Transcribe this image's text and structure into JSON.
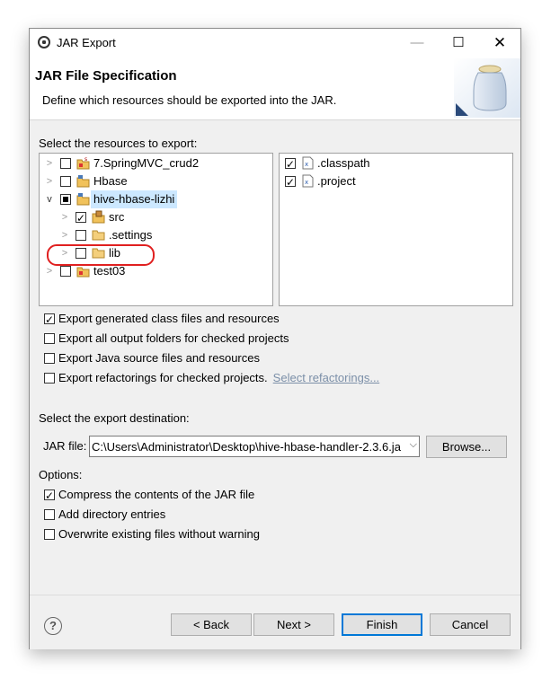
{
  "window": {
    "title": "JAR Export",
    "controls": {
      "minimize": "—",
      "maximize": "☐",
      "close": "✕"
    }
  },
  "banner": {
    "title": "JAR File Specification",
    "description": "Define which resources should be exported into the JAR."
  },
  "resources": {
    "label": "Select the resources to export:",
    "tree": [
      {
        "label": "7.SpringMVC_crud2",
        "state": "unchecked",
        "expander": ">",
        "icon": "project-error-icon"
      },
      {
        "label": "Hbase",
        "state": "unchecked",
        "expander": ">",
        "icon": "project-icon"
      },
      {
        "label": "hive-hbase-lizhi",
        "state": "partial",
        "expander": "v",
        "icon": "project-icon",
        "selected": true
      },
      {
        "label": "src",
        "state": "checked",
        "expander": ">",
        "icon": "package-folder-icon"
      },
      {
        "label": ".settings",
        "state": "unchecked",
        "expander": ">",
        "icon": "folder-icon"
      },
      {
        "label": "lib",
        "state": "unchecked",
        "expander": ">",
        "icon": "folder-icon"
      },
      {
        "label": "test03",
        "state": "unchecked",
        "expander": ">",
        "icon": "project-error-icon"
      }
    ],
    "files": [
      {
        "label": ".classpath",
        "state": "checked",
        "icon": "xml-file-icon"
      },
      {
        "label": ".project",
        "state": "checked",
        "icon": "xml-file-icon"
      }
    ]
  },
  "export_options": [
    {
      "label": "Export generated class files and resources",
      "checked": true
    },
    {
      "label": "Export all output folders for checked projects",
      "checked": false
    },
    {
      "label": "Export Java source files and resources",
      "checked": false
    },
    {
      "label": "Export refactorings for checked projects.",
      "checked": false
    }
  ],
  "select_refactorings_link": "Select refactorings...",
  "destination": {
    "label": "Select the export destination:",
    "jar_label": "JAR file:",
    "jar_value": "C:\\Users\\Administrator\\Desktop\\hive-hbase-handler-2.3.6.ja",
    "browse_label": "Browse..."
  },
  "options": {
    "label": "Options:",
    "items": [
      {
        "label": "Compress the contents of the JAR file",
        "checked": true
      },
      {
        "label": "Add directory entries",
        "checked": false
      },
      {
        "label": "Overwrite existing files without warning",
        "checked": false
      }
    ]
  },
  "buttons": {
    "help": "?",
    "back": "< Back",
    "next": "Next >",
    "finish": "Finish",
    "cancel": "Cancel"
  },
  "colors": {
    "selection": "#cce8ff",
    "default_button_border": "#0078d7",
    "annotation": "#e02020",
    "link": "#7b8fa8"
  }
}
